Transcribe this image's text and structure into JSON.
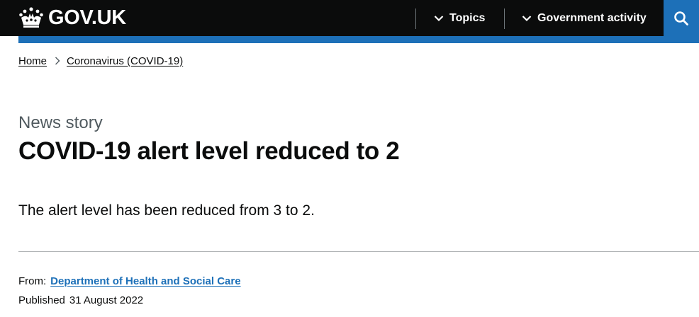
{
  "header": {
    "logo_text": "GOV.UK",
    "nav": [
      {
        "label": "Topics"
      },
      {
        "label": "Government activity"
      }
    ],
    "search_icon": "search-icon",
    "colors": {
      "header_bg": "#0b0c0c",
      "brand_blue": "#1d70b8"
    }
  },
  "breadcrumb": [
    {
      "label": "Home"
    },
    {
      "label": "Coronavirus (COVID-19)"
    }
  ],
  "article": {
    "caption": "News story",
    "title": "COVID-19 alert level reduced to 2",
    "lede": "The alert level has been reduced from 3 to 2."
  },
  "metadata": {
    "from_label": "From:",
    "from_value": "Department of Health and Social Care",
    "published_label": "Published",
    "published_value": "31 August 2022"
  }
}
